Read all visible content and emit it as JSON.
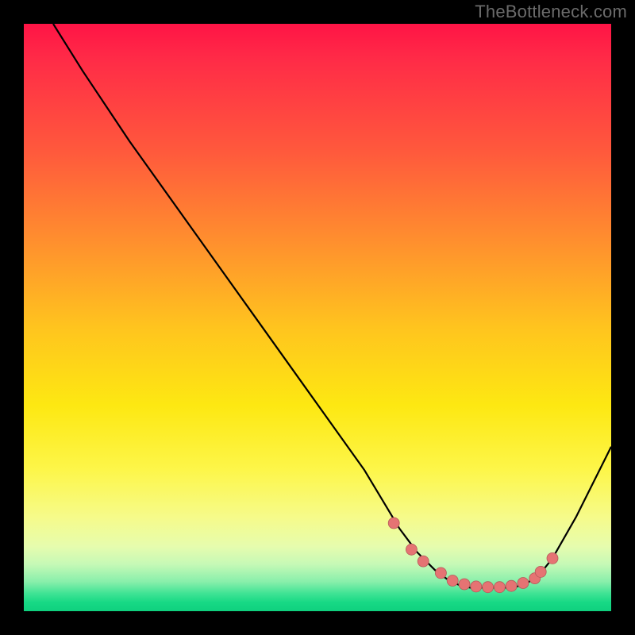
{
  "watermark": "TheBottleneck.com",
  "chart_data": {
    "type": "line",
    "title": "",
    "xlabel": "",
    "ylabel": "",
    "xlim": [
      0,
      100
    ],
    "ylim": [
      0,
      100
    ],
    "grid": false,
    "series": [
      {
        "name": "bottleneck-curve",
        "x": [
          5,
          10,
          18,
          28,
          38,
          48,
          58,
          64,
          67,
          70,
          72,
          74,
          76,
          78,
          80,
          82,
          84,
          86,
          88,
          90,
          94,
          100
        ],
        "y": [
          100,
          92,
          80,
          66,
          52,
          38,
          24,
          14,
          10,
          7,
          5.5,
          4.5,
          4,
          4,
          4,
          4,
          4.2,
          5,
          6.5,
          9,
          16,
          28
        ]
      }
    ],
    "markers": {
      "name": "highlight-points",
      "x": [
        63,
        66,
        68,
        71,
        73,
        75,
        77,
        79,
        81,
        83,
        85,
        87,
        88,
        90
      ],
      "y": [
        15,
        10.5,
        8.5,
        6.5,
        5.2,
        4.6,
        4.2,
        4.1,
        4.1,
        4.3,
        4.8,
        5.6,
        6.7,
        9
      ]
    }
  }
}
